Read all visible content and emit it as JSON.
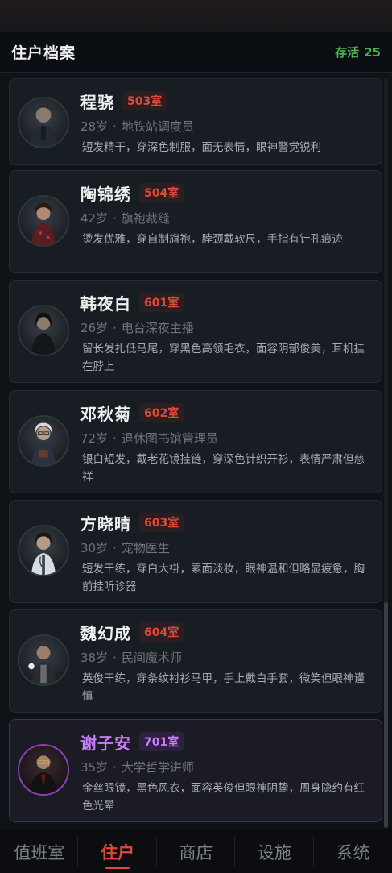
{
  "header": {
    "title": "住户档案",
    "survive_label": "存活",
    "survive_count": "25"
  },
  "residents": [
    {
      "name": "程骁",
      "room": "503室",
      "age": "28岁",
      "job": "地铁站调度员",
      "desc": "短发精干，穿深色制服，面无表情，眼神警觉锐利",
      "avatar": "man-uniform-icon"
    },
    {
      "name": "陶锦绣",
      "room": "504室",
      "age": "42岁",
      "job": "旗袍裁缝",
      "desc": "烫发优雅，穿自制旗袍，脖颈戴软尺，手指有针孔痕迹",
      "avatar": "woman-qipao-icon"
    },
    {
      "name": "韩夜白",
      "room": "601室",
      "age": "26岁",
      "job": "电台深夜主播",
      "desc": "留长发扎低马尾，穿黑色高领毛衣，面容阴郁俊美，耳机挂在脖上",
      "avatar": "man-longhair-icon"
    },
    {
      "name": "邓秋菊",
      "room": "602室",
      "age": "72岁",
      "job": "退休图书馆管理员",
      "desc": "银白短发，戴老花镜挂链，穿深色针织开衫，表情严肃但慈祥",
      "avatar": "elderly-woman-icon"
    },
    {
      "name": "方晓晴",
      "room": "603室",
      "age": "30岁",
      "job": "宠物医生",
      "desc": "短发干练，穿白大褂，素面淡妆，眼神温和但略显疲惫，胸前挂听诊器",
      "avatar": "woman-doctor-icon"
    },
    {
      "name": "魏幻成",
      "room": "604室",
      "age": "38岁",
      "job": "民间魔术师",
      "desc": "英俊干练，穿条纹衬衫马甲，手上戴白手套，微笑但眼神谨慎",
      "avatar": "man-magician-icon"
    },
    {
      "name": "谢子安",
      "room": "701室",
      "age": "35岁",
      "job": "大学哲学讲师",
      "desc": "金丝眼镜，黑色风衣，面容英俊但眼神阴鸷，周身隐约有红色光晕",
      "avatar": "man-glasses-icon"
    }
  ],
  "tabs": [
    {
      "label": "值班室"
    },
    {
      "label": "住户"
    },
    {
      "label": "商店"
    },
    {
      "label": "设施"
    },
    {
      "label": "系统"
    }
  ],
  "colors": {
    "accent": "#e0483a",
    "survive": "#4caf50",
    "vip": "#c77dff"
  }
}
